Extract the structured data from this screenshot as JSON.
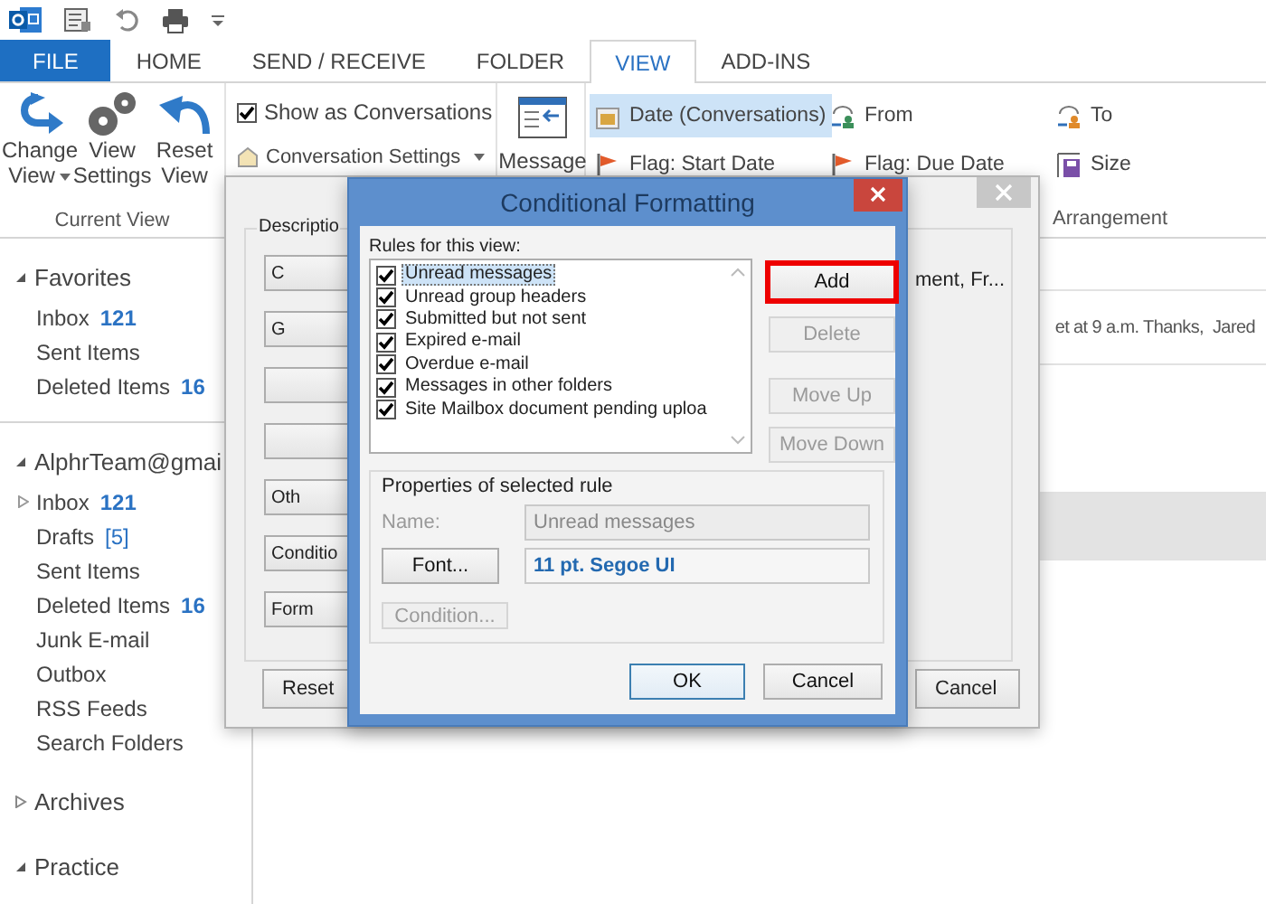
{
  "tabs": [
    {
      "label": "FILE",
      "kind": "file",
      "selected": false
    },
    {
      "label": "HOME",
      "kind": "tab",
      "selected": false
    },
    {
      "label": "SEND / RECEIVE",
      "kind": "tab",
      "selected": false
    },
    {
      "label": "FOLDER",
      "kind": "tab",
      "selected": false
    },
    {
      "label": "VIEW",
      "kind": "tab",
      "selected": true
    },
    {
      "label": "ADD-INS",
      "kind": "tab",
      "selected": false
    }
  ],
  "ribbon": {
    "current_view": {
      "label": "Current View",
      "buttons": [
        {
          "label": "Change View",
          "kind": "change",
          "dropdown": true
        },
        {
          "label": "View Settings",
          "kind": "settings",
          "dropdown": false
        },
        {
          "label": "Reset View",
          "kind": "reset",
          "dropdown": false
        }
      ]
    },
    "show_as_conversations": {
      "label": "Show as Conversations",
      "checked": true
    },
    "conversation_settings": {
      "label": "Conversation Settings",
      "dropdown": true
    },
    "message_button": {
      "label": "Message"
    },
    "arrangement": {
      "label": "Arrangement",
      "items": [
        {
          "label": "Date (Conversations)",
          "kind": "date",
          "selected": true
        },
        {
          "label": "From",
          "kind": "from",
          "selected": false
        },
        {
          "label": "To",
          "kind": "to",
          "selected": false
        },
        {
          "label": "Flag: Start Date",
          "kind": "flag",
          "selected": false
        },
        {
          "label": "Flag: Due Date",
          "kind": "flag",
          "selected": false
        },
        {
          "label": "Size",
          "kind": "size",
          "selected": false
        }
      ]
    }
  },
  "sidebar": {
    "groups": [
      {
        "label": "Favorites",
        "expanded": true,
        "items": [
          {
            "name": "Inbox",
            "count": "121",
            "count_bold": true,
            "expandable": false
          },
          {
            "name": "Sent Items",
            "expandable": false
          },
          {
            "name": "Deleted Items",
            "count": "16",
            "count_bold": true,
            "expandable": false
          }
        ]
      },
      {
        "label": "AlphrTeam@gmai",
        "expanded": true,
        "items": [
          {
            "name": "Inbox",
            "count": "121",
            "count_bold": true,
            "expandable": true
          },
          {
            "name": "Drafts",
            "count": "[5]",
            "count_bold": false,
            "expandable": false
          },
          {
            "name": "Sent Items",
            "expandable": false
          },
          {
            "name": "Deleted Items",
            "count": "16",
            "count_bold": true,
            "expandable": false
          },
          {
            "name": "Junk E-mail",
            "expandable": false
          },
          {
            "name": "Outbox",
            "expandable": false
          },
          {
            "name": "RSS Feeds",
            "expandable": false
          },
          {
            "name": "Search Folders",
            "expandable": false
          }
        ]
      },
      {
        "label": "Archives",
        "expanded": false
      },
      {
        "label": "Practice",
        "expanded": true
      }
    ]
  },
  "message_list": {
    "rows": [
      {
        "preview": "et at 9 a.m. Thanks,  Jared",
        "selected": false
      },
      {
        "selected": false
      },
      {
        "selected": true
      }
    ]
  },
  "view_settings_dialog": {
    "group_label": "Descriptio",
    "summary": "ment, Fr...",
    "buttons": [
      {
        "kind": "labeled",
        "label": "C"
      },
      {
        "kind": "labeled",
        "label": "G"
      },
      {
        "kind": "blank"
      },
      {
        "kind": "blank"
      },
      {
        "kind": "labeled",
        "label": "Oth"
      },
      {
        "kind": "labeled",
        "label": "Conditio"
      },
      {
        "kind": "labeled",
        "label": "Form"
      }
    ],
    "reset": "Reset",
    "cancel": "Cancel"
  },
  "conditional_formatting_dialog": {
    "title": "Conditional Formatting",
    "rules_label": "Rules for this view:",
    "rules": [
      {
        "label": "Unread messages",
        "checked": true,
        "selected": true
      },
      {
        "label": "Unread group headers",
        "checked": true,
        "selected": false
      },
      {
        "label": "Submitted but not sent",
        "checked": true,
        "selected": false
      },
      {
        "label": "Expired e-mail",
        "checked": true,
        "selected": false
      },
      {
        "label": "Overdue e-mail",
        "checked": true,
        "selected": false
      },
      {
        "label": "Messages in other folders",
        "checked": true,
        "selected": false
      },
      {
        "label": "Site Mailbox document pending uploa",
        "checked": true,
        "selected": false
      }
    ],
    "side_buttons": [
      {
        "label": "Add",
        "disabled": false,
        "highlighted": true
      },
      {
        "label": "Delete",
        "disabled": true,
        "highlighted": false
      },
      {
        "label": "Move Up",
        "disabled": true,
        "highlighted": false
      },
      {
        "label": "Move Down",
        "disabled": true,
        "highlighted": false
      }
    ],
    "properties": {
      "label": "Properties of selected rule",
      "name_label": "Name:",
      "name_value": "Unread messages",
      "font_button": "Font...",
      "font_value": "11 pt. Segoe UI",
      "condition_button": "Condition...",
      "condition_disabled": true
    },
    "ok": "OK",
    "cancel": "Cancel"
  }
}
